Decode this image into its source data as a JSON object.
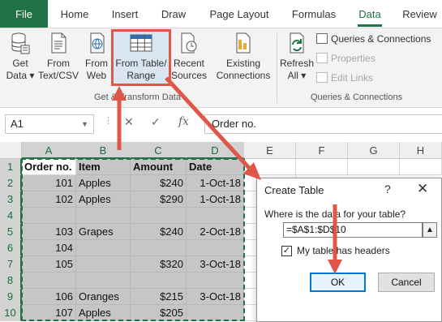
{
  "tabs": [
    {
      "label": "File"
    },
    {
      "label": "Home"
    },
    {
      "label": "Insert"
    },
    {
      "label": "Draw"
    },
    {
      "label": "Page Layout"
    },
    {
      "label": "Formulas"
    },
    {
      "label": "Data",
      "active": true
    },
    {
      "label": "Review"
    }
  ],
  "ribbon": {
    "get_data": {
      "line1": "Get",
      "line2": "Data ▾",
      "icon": "database-icon"
    },
    "from_text_csv": {
      "line1": "From",
      "line2": "Text/CSV",
      "icon": "text-file-icon"
    },
    "from_web": {
      "line1": "From",
      "line2": "Web",
      "icon": "globe-icon"
    },
    "from_table_range": {
      "line1": "From Table/",
      "line2": "Range",
      "icon": "table-icon"
    },
    "recent_sources": {
      "line1": "Recent",
      "line2": "Sources",
      "icon": "clock-file-icon"
    },
    "existing_connections": {
      "line1": "Existing",
      "line2": "Connections",
      "icon": "connections-file-icon"
    },
    "refresh_all": {
      "line1": "Refresh",
      "line2": "All ▾",
      "icon": "refresh-icon"
    },
    "queries_connections": {
      "label": "Queries & Connections"
    },
    "properties": {
      "label": "Properties"
    },
    "edit_links": {
      "label": "Edit Links"
    },
    "group_get_transform": "Get & Transform Data",
    "group_queries": "Queries & Connections"
  },
  "formula_bar": {
    "name_box": "A1",
    "cancel_symbol": "✕",
    "enter_symbol": "✓",
    "fx_symbol": "fx",
    "value": "Order no."
  },
  "sheet": {
    "columns": [
      "A",
      "B",
      "C",
      "D",
      "E",
      "F",
      "G",
      "H"
    ],
    "rows": [
      "1",
      "2",
      "3",
      "4",
      "5",
      "6",
      "7",
      "8",
      "9",
      "10"
    ],
    "cells": [
      [
        "Order no.",
        "Item",
        "Amount",
        "Date"
      ],
      [
        "101",
        "Apples",
        "$240",
        "1-Oct-18"
      ],
      [
        "102",
        "Apples",
        "$290",
        "1-Oct-18"
      ],
      [
        "",
        "",
        "",
        ""
      ],
      [
        "103",
        "Grapes",
        "$240",
        "2-Oct-18"
      ],
      [
        "104",
        "",
        "",
        ""
      ],
      [
        "105",
        "",
        "$320",
        "3-Oct-18"
      ],
      [
        "",
        "",
        "",
        ""
      ],
      [
        "106",
        "Oranges",
        "$215",
        "3-Oct-18"
      ],
      [
        "107",
        "Apples",
        "$205",
        ""
      ]
    ]
  },
  "dialog": {
    "title": "Create Table",
    "help": "?",
    "close": "✕",
    "question": "Where is the data for your table?",
    "range": "=$A$1:$D$10",
    "has_headers_label": "My table has headers",
    "has_headers_checked": true,
    "ok_label": "OK",
    "cancel_label": "Cancel"
  },
  "colors": {
    "accent": "#217346",
    "highlight": "#e0574a",
    "selection": "#c6c6c6",
    "ok_border": "#0078d7"
  }
}
